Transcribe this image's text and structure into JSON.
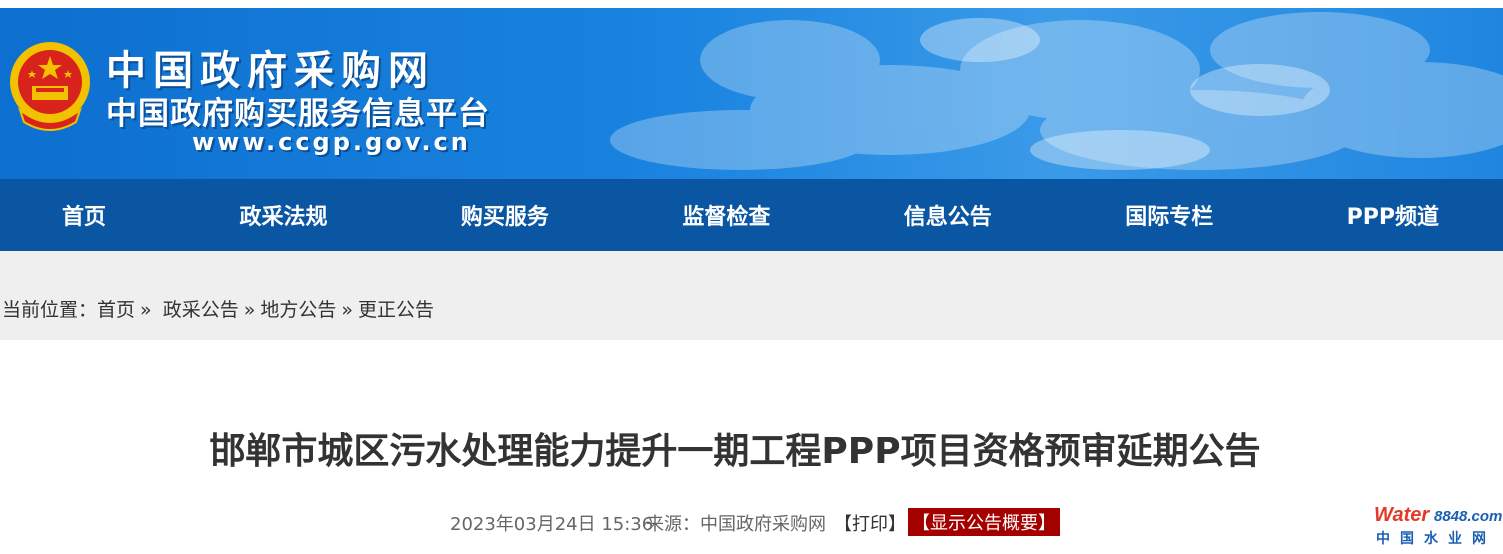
{
  "header": {
    "site_name": "中国政府采购网",
    "site_subtitle": "中国政府购买服务信息平台",
    "site_url": "www.ccgp.gov.cn"
  },
  "nav": {
    "items": [
      "首页",
      "政采法规",
      "购买服务",
      "监督检查",
      "信息公告",
      "国际专栏",
      "PPP频道"
    ]
  },
  "breadcrumb": {
    "prefix": "当前位置：",
    "items": [
      "首页",
      "政采公告",
      "地方公告",
      "更正公告"
    ],
    "separator": "»"
  },
  "article": {
    "title": "邯郸市城区污水处理能力提升一期工程PPP项目资格预审延期公告",
    "date": "2023年03月24日 15:36",
    "source": "来源：中国政府采购网",
    "print_label": "【打印】",
    "summary_label": "【显示公告概要】"
  },
  "watermark": {
    "brand_a": "Water",
    "brand_b": "8848.com",
    "cn": "中国水业网"
  },
  "colors": {
    "nav_bg": "#0a56a3",
    "banner_blue": "#1a84e0",
    "summary_bg": "#a40000"
  },
  "icons": [
    "national-emblem-icon"
  ]
}
